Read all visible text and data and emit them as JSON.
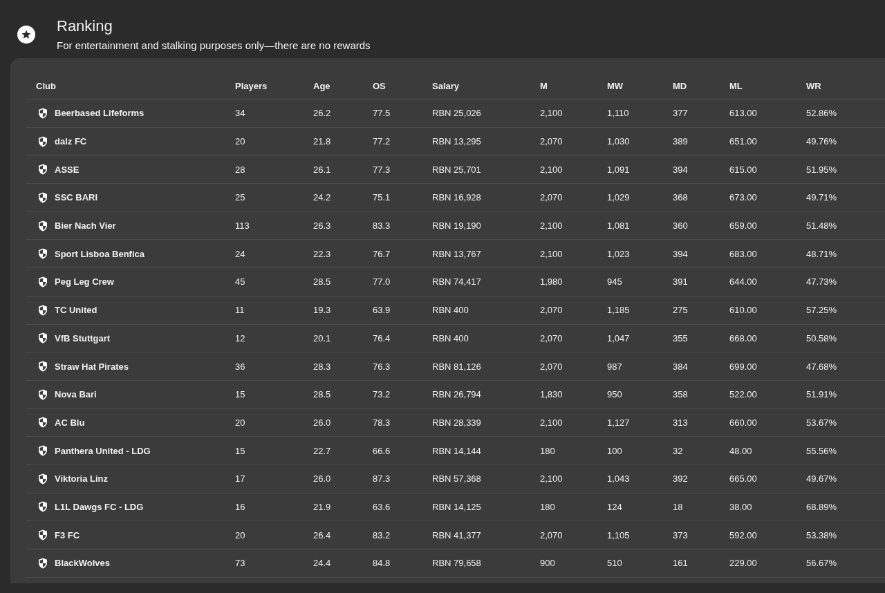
{
  "header": {
    "title": "Ranking",
    "subtitle": "For entertainment and stalking purposes only—there are no rewards"
  },
  "table": {
    "columns": [
      "Club",
      "Players",
      "Age",
      "OS",
      "Salary",
      "M",
      "MW",
      "MD",
      "ML",
      "WR"
    ],
    "rows": [
      [
        "Beerbased Lifeforms",
        "34",
        "26.2",
        "77.5",
        "RBN 25,026",
        "2,100",
        "1,110",
        "377",
        "613.00",
        "52.86%"
      ],
      [
        "dalz FC",
        "20",
        "21.8",
        "77.2",
        "RBN 13,295",
        "2,070",
        "1,030",
        "389",
        "651.00",
        "49.76%"
      ],
      [
        "ASSE",
        "28",
        "26.1",
        "77.3",
        "RBN 25,701",
        "2,100",
        "1,091",
        "394",
        "615.00",
        "51.95%"
      ],
      [
        "SSC BARI",
        "25",
        "24.2",
        "75.1",
        "RBN 16,928",
        "2,070",
        "1,029",
        "368",
        "673.00",
        "49.71%"
      ],
      [
        "Bier Nach Vier",
        "113",
        "26.3",
        "83.3",
        "RBN 19,190",
        "2,100",
        "1,081",
        "360",
        "659.00",
        "51.48%"
      ],
      [
        "Sport Lisboa Benfica",
        "24",
        "22.3",
        "76.7",
        "RBN 13,767",
        "2,100",
        "1,023",
        "394",
        "683.00",
        "48.71%"
      ],
      [
        "Peg Leg Crew",
        "45",
        "28.5",
        "77.0",
        "RBN 74,417",
        "1,980",
        "945",
        "391",
        "644.00",
        "47.73%"
      ],
      [
        "TC United",
        "11",
        "19.3",
        "63.9",
        "RBN 400",
        "2,070",
        "1,185",
        "275",
        "610.00",
        "57.25%"
      ],
      [
        "VfB Stuttgart",
        "12",
        "20.1",
        "76.4",
        "RBN 400",
        "2,070",
        "1,047",
        "355",
        "668.00",
        "50.58%"
      ],
      [
        "Straw Hat Pirates",
        "36",
        "28.3",
        "76.3",
        "RBN 81,126",
        "2,070",
        "987",
        "384",
        "699.00",
        "47.68%"
      ],
      [
        "Nova Bari",
        "15",
        "28.5",
        "73.2",
        "RBN 26,794",
        "1,830",
        "950",
        "358",
        "522.00",
        "51.91%"
      ],
      [
        "AC Blu",
        "20",
        "26.0",
        "78.3",
        "RBN 28,339",
        "2,100",
        "1,127",
        "313",
        "660.00",
        "53.67%"
      ],
      [
        "Panthera United - LDG",
        "15",
        "22.7",
        "66.6",
        "RBN 14,144",
        "180",
        "100",
        "32",
        "48.00",
        "55.56%"
      ],
      [
        "Viktoria Linz",
        "17",
        "26.0",
        "87.3",
        "RBN 57,368",
        "2,100",
        "1,043",
        "392",
        "665.00",
        "49.67%"
      ],
      [
        "L1L Dawgs FC - LDG",
        "16",
        "21.9",
        "63.6",
        "RBN 14,125",
        "180",
        "124",
        "18",
        "38.00",
        "68.89%"
      ],
      [
        "F3 FC",
        "20",
        "26.4",
        "83.2",
        "RBN 41,377",
        "2,070",
        "1,105",
        "373",
        "592.00",
        "53.38%"
      ],
      [
        "BlackWolves",
        "73",
        "24.4",
        "84.8",
        "RBN 79,658",
        "900",
        "510",
        "161",
        "229.00",
        "56.67%"
      ]
    ]
  }
}
